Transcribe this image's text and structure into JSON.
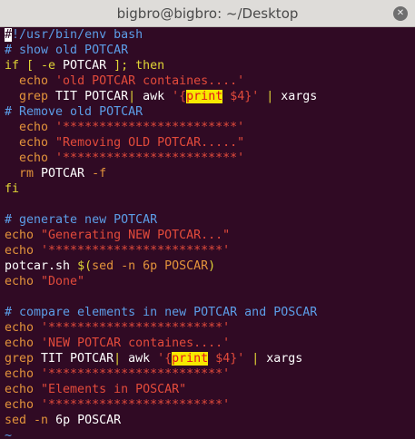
{
  "window": {
    "title": "bigbro@bigbro: ~/Desktop",
    "close_glyph": "✕"
  },
  "editor": {
    "lines": [
      [
        {
          "t": "#",
          "c": "cur"
        },
        {
          "t": "!/usr/bin/env bash",
          "c": "c"
        }
      ],
      [
        {
          "t": "# show old POTCAR",
          "c": "c"
        }
      ],
      [
        {
          "t": "if [ -e ",
          "c": "k"
        },
        {
          "t": "POTCAR",
          "c": "w"
        },
        {
          "t": " ]; then",
          "c": "k"
        }
      ],
      [
        {
          "t": "  echo ",
          "c": "b"
        },
        {
          "t": "'old POTCAR containes....'",
          "c": "s"
        }
      ],
      [
        {
          "t": "  grep ",
          "c": "b"
        },
        {
          "t": "TIT POTCAR",
          "c": "w"
        },
        {
          "t": "| ",
          "c": "k"
        },
        {
          "t": "awk ",
          "c": "w"
        },
        {
          "t": "'{",
          "c": "s"
        },
        {
          "t": "print",
          "c": "hl"
        },
        {
          "t": " $4}'",
          "c": "s"
        },
        {
          "t": " | ",
          "c": "k"
        },
        {
          "t": "xargs",
          "c": "w"
        }
      ],
      [
        {
          "t": "# Remove old POTCAR",
          "c": "c"
        }
      ],
      [
        {
          "t": "  echo ",
          "c": "b"
        },
        {
          "t": "'************************'",
          "c": "s"
        }
      ],
      [
        {
          "t": "  echo ",
          "c": "b"
        },
        {
          "t": "\"Removing OLD POTCAR.....\"",
          "c": "s"
        }
      ],
      [
        {
          "t": "  echo ",
          "c": "b"
        },
        {
          "t": "'************************'",
          "c": "s"
        }
      ],
      [
        {
          "t": "  rm ",
          "c": "b"
        },
        {
          "t": "POTCAR ",
          "c": "w"
        },
        {
          "t": "-f",
          "c": "b"
        }
      ],
      [
        {
          "t": "fi",
          "c": "k"
        }
      ],
      [
        {
          "t": "",
          "c": "w"
        }
      ],
      [
        {
          "t": "# generate new POTCAR",
          "c": "c"
        }
      ],
      [
        {
          "t": "echo ",
          "c": "b"
        },
        {
          "t": "\"Generating NEW POTCAR...\"",
          "c": "s"
        }
      ],
      [
        {
          "t": "echo ",
          "c": "b"
        },
        {
          "t": "'************************'",
          "c": "s"
        }
      ],
      [
        {
          "t": "potcar.sh ",
          "c": "w"
        },
        {
          "t": "$(",
          "c": "k"
        },
        {
          "t": "sed -n 6p POSCAR",
          "c": "b"
        },
        {
          "t": ")",
          "c": "k"
        }
      ],
      [
        {
          "t": "echo ",
          "c": "b"
        },
        {
          "t": "\"Done\"",
          "c": "s"
        }
      ],
      [
        {
          "t": "",
          "c": "w"
        }
      ],
      [
        {
          "t": "# compare elements in new POTCAR and POSCAR",
          "c": "c"
        }
      ],
      [
        {
          "t": "echo ",
          "c": "b"
        },
        {
          "t": "'************************'",
          "c": "s"
        }
      ],
      [
        {
          "t": "echo ",
          "c": "b"
        },
        {
          "t": "'NEW POTCAR containes....'",
          "c": "s"
        }
      ],
      [
        {
          "t": "grep ",
          "c": "b"
        },
        {
          "t": "TIT POTCAR",
          "c": "w"
        },
        {
          "t": "| ",
          "c": "k"
        },
        {
          "t": "awk ",
          "c": "w"
        },
        {
          "t": "'{",
          "c": "s"
        },
        {
          "t": "print",
          "c": "hl"
        },
        {
          "t": " $4}'",
          "c": "s"
        },
        {
          "t": " | ",
          "c": "k"
        },
        {
          "t": "xargs",
          "c": "w"
        }
      ],
      [
        {
          "t": "echo ",
          "c": "b"
        },
        {
          "t": "'************************'",
          "c": "s"
        }
      ],
      [
        {
          "t": "echo ",
          "c": "b"
        },
        {
          "t": "\"Elements in POSCAR\"",
          "c": "s"
        }
      ],
      [
        {
          "t": "echo ",
          "c": "b"
        },
        {
          "t": "'************************'",
          "c": "s"
        }
      ],
      [
        {
          "t": "sed ",
          "c": "b"
        },
        {
          "t": "-n ",
          "c": "b"
        },
        {
          "t": "6p POSCAR",
          "c": "w"
        }
      ],
      [
        {
          "t": "~",
          "c": "tilde"
        }
      ]
    ]
  },
  "colors": {
    "background": "#300a24",
    "comment": "#5c9ee8",
    "keyword": "#dfd436",
    "string": "#e34b3b",
    "builtin": "#e3933b",
    "search_highlight": "#f6e900"
  }
}
